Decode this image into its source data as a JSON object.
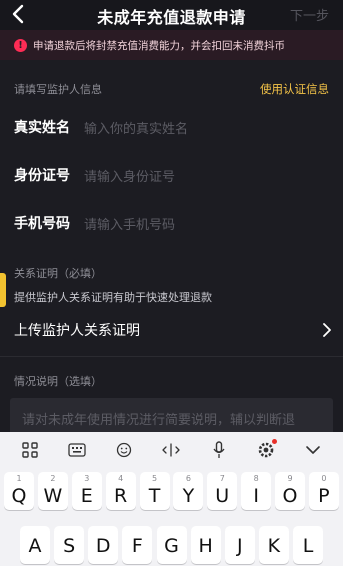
{
  "header": {
    "title": "未成年充值退款申请",
    "next_label": "下一步",
    "back_icon": "chevron-left-icon"
  },
  "warning": {
    "icon": "exclamation-icon",
    "text": "申请退款后将封禁充值消费能力，并会扣回未消费抖币"
  },
  "guardian_section": {
    "label": "请填写监护人信息",
    "auth_link": "使用认证信息"
  },
  "form": {
    "fields": [
      {
        "label": "真实姓名",
        "placeholder": "输入你的真实姓名"
      },
      {
        "label": "身份证号",
        "placeholder": "请输入身份证号"
      },
      {
        "label": "手机号码",
        "placeholder": "请输入手机号码"
      }
    ]
  },
  "relation": {
    "label": "关系证明（必填）",
    "note": "提供监护人关系证明有助于快速处理退款",
    "upload_label": "上传监护人关系证明"
  },
  "situation": {
    "label": "情况说明（选填）",
    "placeholder": "请对未成年使用情况进行简要说明，辅以判断退"
  },
  "keyboard": {
    "toolbar_icons": [
      "grid-icon",
      "keyboard-icon",
      "emoji-icon",
      "cursor-move-icon",
      "microphone-icon",
      "gear-icon",
      "chevron-down-icon"
    ],
    "row1": [
      {
        "num": "1",
        "letter": "Q"
      },
      {
        "num": "2",
        "letter": "W"
      },
      {
        "num": "3",
        "letter": "E"
      },
      {
        "num": "4",
        "letter": "R"
      },
      {
        "num": "5",
        "letter": "T"
      },
      {
        "num": "6",
        "letter": "Y"
      },
      {
        "num": "7",
        "letter": "U"
      },
      {
        "num": "8",
        "letter": "I"
      },
      {
        "num": "9",
        "letter": "O"
      },
      {
        "num": "0",
        "letter": "P"
      }
    ],
    "row2_partial": [
      "A",
      "S",
      "D",
      "F",
      "G",
      "H",
      "J",
      "K",
      "L"
    ]
  },
  "colors": {
    "accent": "#fe2c55",
    "link": "#f5c448",
    "background": "#1c1c22"
  }
}
